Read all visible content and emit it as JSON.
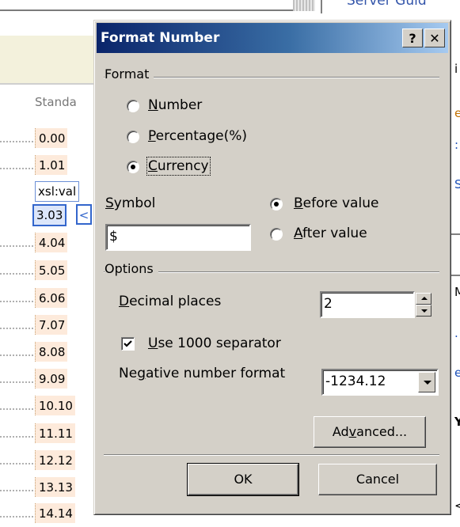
{
  "background": {
    "top_link": "Server Guid",
    "column_header": "Standa",
    "rows": [
      "0.00",
      "1.01",
      "xsl:val",
      "3.03",
      "4.04",
      "5.05",
      "6.06",
      "7.07",
      "8.08",
      "9.09",
      "10.10",
      "11.11",
      "12.12",
      "13.13",
      "14.14"
    ],
    "selected_arrow": "<",
    "right_glyphs": [
      "i",
      "e",
      ":",
      "S",
      "M",
      ".",
      "e",
      "Y",
      "<"
    ]
  },
  "dialog": {
    "title": "Format Number",
    "help_label": "?",
    "close_label": "✕",
    "format_group": "Format",
    "format_options": [
      {
        "label_pre": "",
        "label_acc": "N",
        "label_post": "umber",
        "checked": false
      },
      {
        "label_pre": "",
        "label_acc": "P",
        "label_post": "ercentage(%)",
        "checked": false
      },
      {
        "label_pre": "",
        "label_acc": "C",
        "label_post": "urrency",
        "checked": true
      }
    ],
    "symbol_label_acc": "S",
    "symbol_label_post": "ymbol",
    "symbol_value": "$",
    "position_options": [
      {
        "label_acc": "B",
        "label_post": "efore value",
        "checked": true
      },
      {
        "label_acc": "A",
        "label_post": "fter value",
        "checked": false
      }
    ],
    "options_group": "Options",
    "decimal_label_acc": "D",
    "decimal_label_post": "ecimal places",
    "decimal_value": "2",
    "separator_label_acc": "U",
    "separator_label_post": "se 1000 separator",
    "separator_checked": true,
    "negative_label_pre": "Ne",
    "negative_label_acc": "g",
    "negative_label_post": "ative number format",
    "negative_value": "-1234.12",
    "advanced_pre": "Ad",
    "advanced_acc": "v",
    "advanced_post": "anced...",
    "ok_label": "OK",
    "cancel_label": "Cancel"
  }
}
